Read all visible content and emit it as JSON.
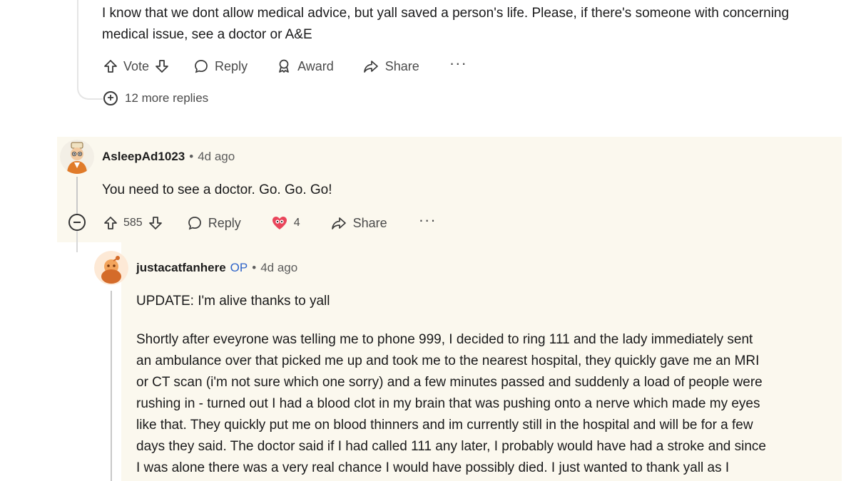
{
  "top_comment": {
    "body": "I know that we dont allow medical advice, but yall saved a person's life. Please, if there's someone with concerning medical issue, see a doctor or A&E",
    "actions": {
      "vote_label": "Vote",
      "reply_label": "Reply",
      "award_label": "Award",
      "share_label": "Share",
      "more_label": "···"
    },
    "more_replies_label": "12 more replies"
  },
  "comment_1": {
    "username": "AsleepAd1023",
    "separator": "•",
    "time": "4d ago",
    "body": "You need to see a doctor. Go. Go. Go!",
    "actions": {
      "score": "585",
      "reply_label": "Reply",
      "award_count": "4",
      "share_label": "Share",
      "more_label": "···"
    }
  },
  "reply_1": {
    "username": "justacatfanhere",
    "op_badge": "OP",
    "separator": "•",
    "time": "4d ago",
    "paragraph_1": "UPDATE: I'm alive thanks to yall",
    "paragraph_2_lines": [
      "Shortly after eveyrone was telling me to phone 999, I decided to ring 111 and the lady immediately sent",
      "an ambulance over that picked me up and took me to the nearest hospital, they quickly gave me an MRI",
      "or CT scan (i'm not sure which one sorry) and a few minutes passed and suddenly a load of people were",
      "rushing in - turned out I had a blood clot in my brain that was pushing onto a nerve which made my eyes",
      "like that. They quickly put me on blood thinners and im currently still in the hospital and will be for a few",
      "days they said. The doctor said if I had called 111 any later, I probably would have had a stroke and since",
      "I was alone there was a very real chance I would have possibly died. I just wanted to thank yall as I"
    ]
  },
  "colors": {
    "highlight_background": "#fbf8ee",
    "op_badge": "#2f64c9",
    "text": "#1a1a1b",
    "muted_text": "#5c5c5c"
  }
}
